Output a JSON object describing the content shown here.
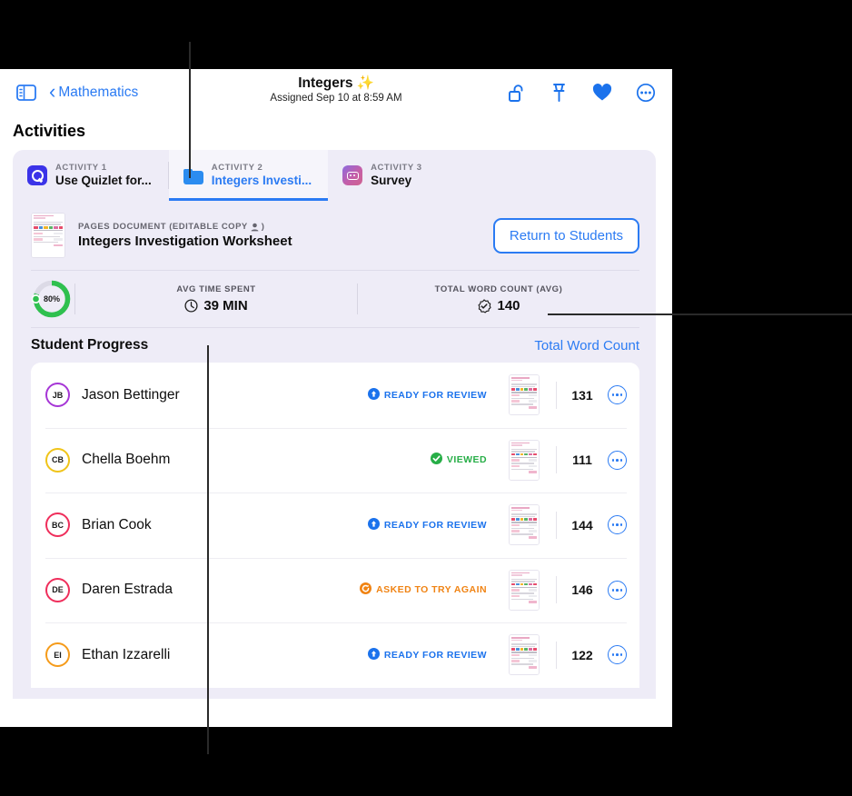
{
  "toolbar": {
    "sidebar_toggle_name": "sidebar-toggle-icon",
    "back_label": "Mathematics",
    "title": "Integers",
    "title_sparkle": "✨",
    "subtitle": "Assigned Sep 10 at 8:59 AM",
    "icons": [
      "unlock-icon",
      "pin-icon",
      "heart-icon",
      "more-circle-icon"
    ]
  },
  "page": {
    "activities_heading": "Activities"
  },
  "tabs": [
    {
      "kicker": "ACTIVITY 1",
      "label": "Use Quizlet for...",
      "icon": "quizlet-icon",
      "active": false
    },
    {
      "kicker": "ACTIVITY 2",
      "label": "Integers Investi...",
      "icon": "folder-icon",
      "active": true
    },
    {
      "kicker": "ACTIVITY 3",
      "label": "Survey",
      "icon": "survey-icon",
      "active": false
    }
  ],
  "document": {
    "kicker": "PAGES DOCUMENT (EDITABLE COPY",
    "kicker_end": ")",
    "person_icon": "person-icon",
    "name": "Integers Investigation Worksheet",
    "return_button": "Return to Students"
  },
  "stats": {
    "ring_percent": "80%",
    "ring_value": 80,
    "ring_color": "#2fc04f",
    "items": [
      {
        "label": "AVG TIME SPENT",
        "value": "39 MIN",
        "icon": "clock-icon"
      },
      {
        "label": "TOTAL WORD COUNT (AVG)",
        "value": "140",
        "icon": "seal-check-icon"
      }
    ]
  },
  "student_progress": {
    "title": "Student Progress",
    "link": "Total Word Count"
  },
  "students": [
    {
      "initials": "JB",
      "name": "Jason Bettinger",
      "ring": "#a636d6",
      "status": "READY FOR REVIEW",
      "status_type": "ready",
      "status_color": "#1b72ec",
      "word_count": "131"
    },
    {
      "initials": "CB",
      "name": "Chella Boehm",
      "ring": "#f0c419",
      "status": "VIEWED",
      "status_type": "viewed",
      "status_color": "#27ae47",
      "word_count": "111"
    },
    {
      "initials": "BC",
      "name": "Brian Cook",
      "ring": "#ef2e5b",
      "status": "READY FOR REVIEW",
      "status_type": "ready",
      "status_color": "#1b72ec",
      "word_count": "144"
    },
    {
      "initials": "DE",
      "name": "Daren Estrada",
      "ring": "#ef2e5b",
      "status": "ASKED TO TRY AGAIN",
      "status_type": "retry",
      "status_color": "#f08313",
      "word_count": "146"
    },
    {
      "initials": "EI",
      "name": "Ethan Izzarelli",
      "ring": "#f59b1a",
      "status": "READY FOR REVIEW",
      "status_type": "ready",
      "status_color": "#1b72ec",
      "word_count": "122"
    }
  ]
}
